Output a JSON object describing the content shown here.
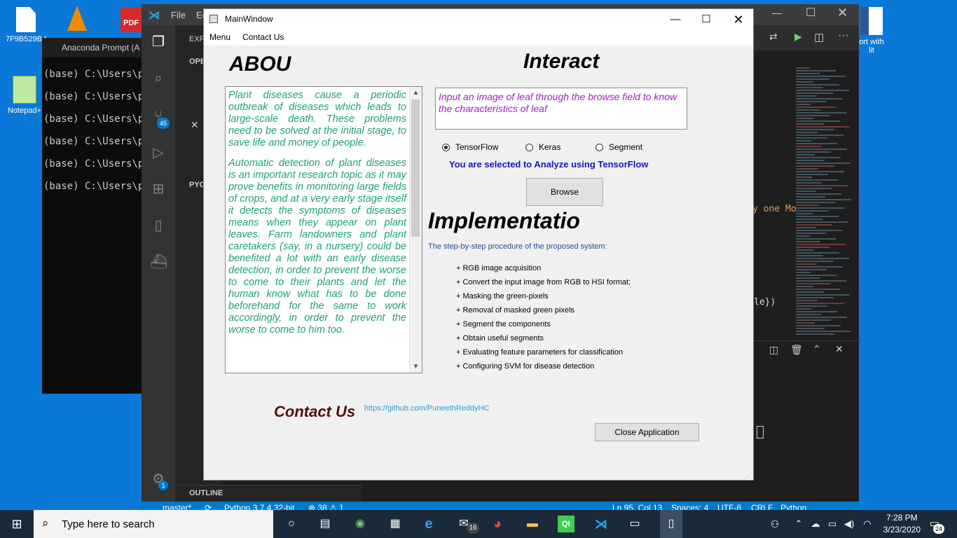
{
  "desktop": {
    "icons": [
      {
        "label": "7F9B529B.t"
      },
      {
        "label": "Notepad+"
      },
      {
        "label": "ort with\nlit"
      }
    ]
  },
  "anaconda": {
    "title": "Anaconda Prompt (A",
    "lines": [
      "(base) C:\\Users\\pu",
      "(base) C:\\Users\\pu",
      "(base) C:\\Users\\pu",
      "(base) C:\\Users\\pu",
      "(base) C:\\Users\\pu",
      "(base) C:\\Users\\pu"
    ]
  },
  "vscode": {
    "menu_file": "File",
    "menu_edit": "Ed",
    "explorer_label": "EXP",
    "section_open": "OPE",
    "section_pyc": "PYC",
    "outline_label": "OUTLINE",
    "source_control_badge": "45",
    "settings_badge": "1",
    "editor_snippet_1": "y one Mo",
    "editor_snippet_2": "le})",
    "status": {
      "branch": "master*",
      "python": "Python 3.7.4 32-bit",
      "problems": "⊗ 38 ⚠ 1",
      "position": "Ln 95, Col 13",
      "spaces": "Spaces: 4",
      "encoding": "UTF-8",
      "eol": "CRLF",
      "language": "Python"
    }
  },
  "mainwindow": {
    "title": "MainWindow",
    "menu": [
      "Menu",
      "Contact Us"
    ],
    "about_heading": "ABOU",
    "about_paragraphs": [
      "Plant diseases cause a periodic outbreak of diseases which leads to large-scale death. These problems need to be solved at the initial stage, to save life and money of people.",
      "Automatic detection of plant diseases is an important research topic as it may prove benefits in monitoring large fields of crops, and at a very early stage itself it detects the symptoms of diseases means when they appear on plant leaves. Farm landowners and plant caretakers (say, in a nursery) could be benefited a lot with an early disease detection, in order to prevent the worse to come to their plants and let the human know what has to be done beforehand for the same to work accordingly, in order to prevent the worse to come to him too."
    ],
    "interact_heading": "Interact",
    "interact_text": "Input an image of leaf through the browse field to know the characteristics of leaf",
    "radios": [
      {
        "label": "TensorFlow",
        "checked": true
      },
      {
        "label": "Keras",
        "checked": false
      },
      {
        "label": "Segment",
        "checked": false
      }
    ],
    "selected_text": "You are selected to Analyze using TensorFlow",
    "browse_label": "Browse",
    "implementation_heading": "Implementatio",
    "implementation_subtitle": "The step-by-step procedure of the proposed system:",
    "steps": [
      "+ RGB image acquisition",
      "+ Convert the input image from RGB to HSI format;",
      "+ Masking the green-pixels",
      "+ Removal of masked green pixels",
      "+ Segment the components",
      "+ Obtain useful segments",
      "+ Evaluating feature parameters for classification",
      "+ Configuring SVM for disease detection"
    ],
    "contact_heading": "Contact Us",
    "contact_link": "https://github.com/PuneethReddyHC",
    "close_label": "Close Application"
  },
  "taskbar": {
    "search_placeholder": "Type here to search",
    "mail_badge": "16",
    "time": "7:28 PM",
    "date": "3/23/2020",
    "notification_count": "24"
  },
  "colors": {
    "desktop": "#0a78d7",
    "about_text": "#1fa07a",
    "interact_text": "#a020c0",
    "selected_text": "#1414c8",
    "contact_heading": "#5a0a0a",
    "link": "#2a9fd6",
    "vscode_status": "#007acc"
  }
}
